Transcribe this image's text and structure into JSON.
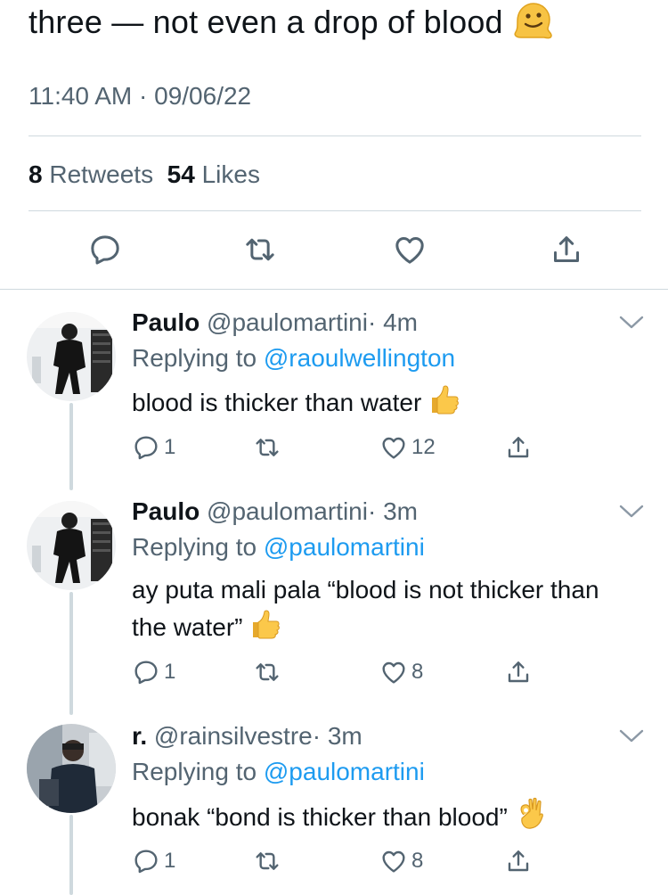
{
  "tweet": {
    "text": "three — not even a drop of blood",
    "emoji": "melting-face",
    "time": "11:40 AM",
    "separator": "·",
    "date": "09/06/22",
    "retweets_count": "8",
    "retweets_label": "Retweets",
    "likes_count": "54",
    "likes_label": "Likes"
  },
  "replies": [
    {
      "name": "Paulo",
      "handle": "@paulomartini",
      "time": "· 4m",
      "replying_label": "Replying to",
      "replying_to": "@raoulwellington",
      "text": "blood is thicker than water",
      "emoji": "thumbs-up",
      "reply_count": "1",
      "like_count": "12"
    },
    {
      "name": "Paulo",
      "handle": "@paulomartini",
      "time": "· 3m",
      "replying_label": "Replying to",
      "replying_to": "@paulomartini",
      "text": "ay puta mali pala “blood is not thicker than the water”",
      "emoji": "thumbs-up",
      "reply_count": "1",
      "like_count": "8"
    },
    {
      "name": "r.",
      "handle": "@rainsilvestre",
      "time": "· 3m",
      "replying_label": "Replying to",
      "replying_to": "@paulomartini",
      "text": "bonak “bond is thicker than blood”",
      "emoji": "ok-hand",
      "reply_count": "1",
      "like_count": "8"
    }
  ],
  "colors": {
    "text": "#0f1419",
    "secondary": "#536471",
    "link": "#1d9bf0",
    "divider": "#cfd9de",
    "emoji_yellow": "#f7c344"
  }
}
